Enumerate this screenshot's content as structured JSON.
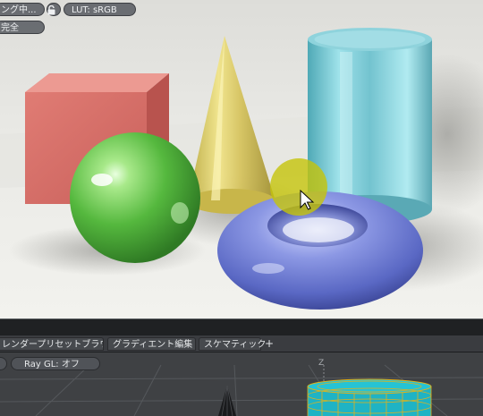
{
  "render_view": {
    "status_label": "ング中...",
    "lock_icon": "lock-icon",
    "lut_label": "LUT: sRGB",
    "quality_label": "完全"
  },
  "tabs": [
    {
      "label": "レンダープリセットブラウザ"
    },
    {
      "label": "グラディエント編集"
    },
    {
      "label": "スケマティック"
    },
    {
      "label": "+"
    }
  ],
  "viewport": {
    "raygl_label": "Ray GL: オフ",
    "axis_label": "Z"
  },
  "colors": {
    "cube": "#d9726d",
    "cone": "#d6c45a",
    "cylinder": "#7cc8d4",
    "sphere": "#5fbf4a",
    "torus": "#6f7fd6",
    "selected_wire": "#e0b21a",
    "cylinder_wire": "#1fb3c4"
  }
}
